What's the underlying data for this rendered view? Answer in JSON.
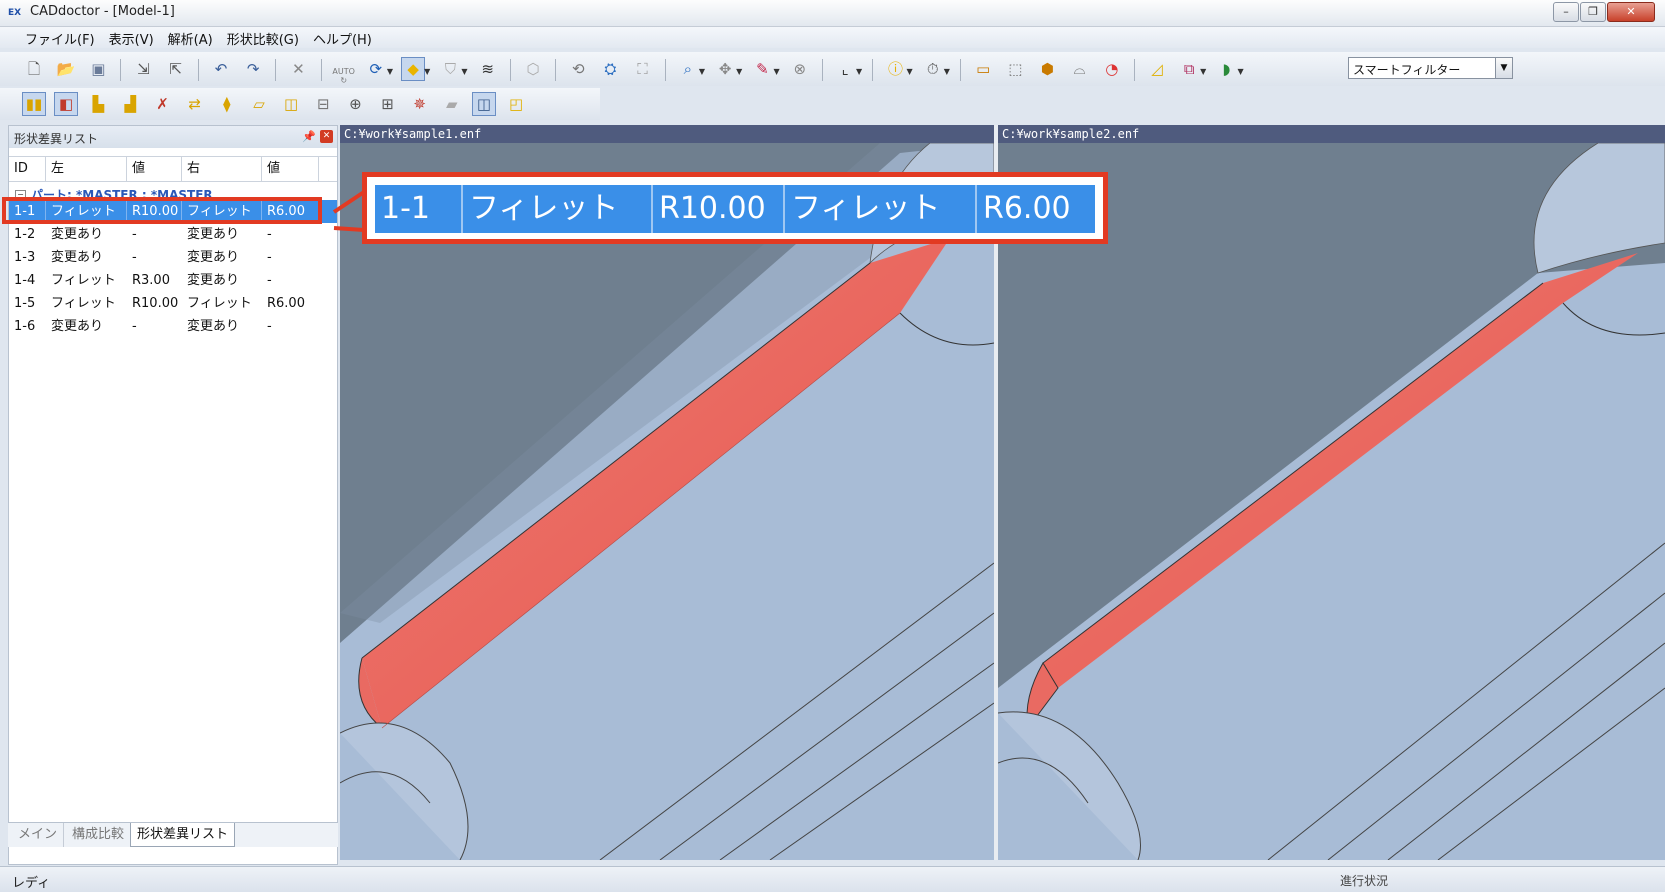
{
  "window": {
    "title": "CADdoctor - [Model-1]",
    "app_icon_text": "EX",
    "controls": [
      "–",
      "❐",
      "✕"
    ]
  },
  "menu": [
    "ファイル(F)",
    "表示(V)",
    "解析(A)",
    "形状比較(G)",
    "ヘルプ(H)"
  ],
  "toolbar": {
    "auto_label": "AUTO",
    "filter_value": "スマートフィルター"
  },
  "panel": {
    "title": "形状差異リスト",
    "columns": [
      "ID",
      "左",
      "値",
      "右",
      "値"
    ],
    "group_label": "パート: *MASTER : *MASTER",
    "group_toggle": "−",
    "rows": [
      [
        "1-1",
        "フィレット",
        "R10.00",
        "フィレット",
        "R6.00"
      ],
      [
        "1-2",
        "変更あり",
        "-",
        "変更あり",
        "-"
      ],
      [
        "1-3",
        "変更あり",
        "-",
        "変更あり",
        "-"
      ],
      [
        "1-4",
        "フィレット",
        "R3.00",
        "変更あり",
        "-"
      ],
      [
        "1-5",
        "フィレット",
        "R10.00",
        "フィレット",
        "R6.00"
      ],
      [
        "1-6",
        "変更あり",
        "-",
        "変更あり",
        "-"
      ]
    ],
    "selected_row": 0,
    "tabs": [
      "メイン",
      "構成比較",
      "形状差異リスト"
    ],
    "active_tab": 2
  },
  "viewports": {
    "left_path": "C:¥work¥sample1.enf",
    "right_path": "C:¥work¥sample2.enf"
  },
  "callout": [
    "1-1",
    "フィレット",
    "R10.00",
    "フィレット",
    "R6.00"
  ],
  "status": {
    "left": "レディ",
    "right": "進行状況"
  },
  "colors": {
    "selection": "#3a8fe8",
    "highlight_outline": "#e23a22",
    "fillet": "#e9615a",
    "surface": "#a8bcd6",
    "background": "#6f7f8f"
  }
}
